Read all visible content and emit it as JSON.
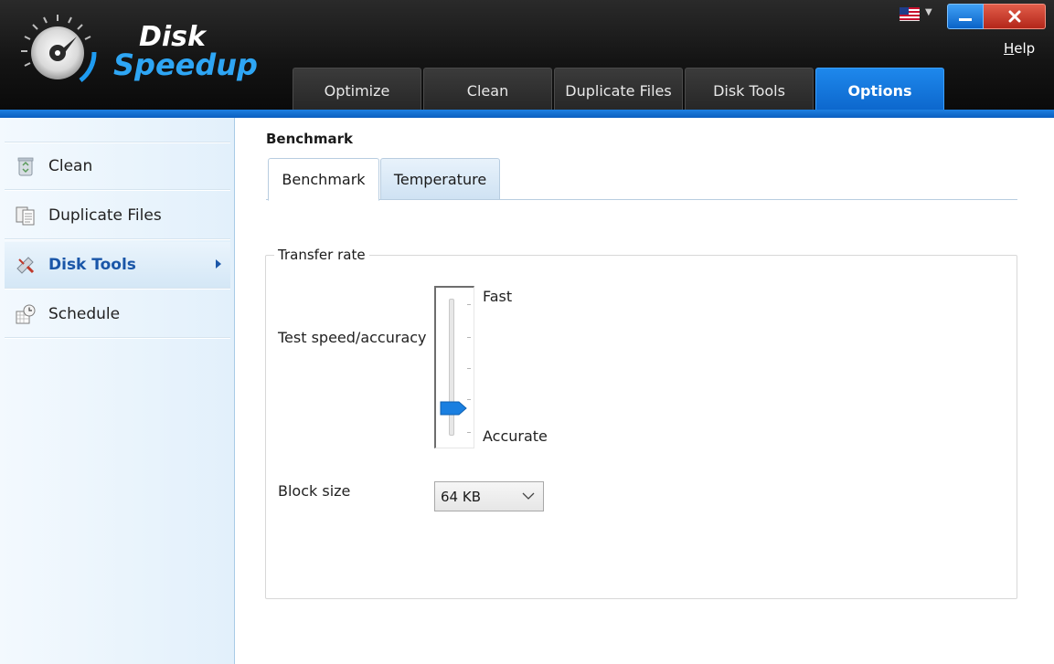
{
  "app": {
    "logo_line1": "Disk",
    "logo_line2": "Speedup",
    "help_label_first": "H",
    "help_label_rest": "elp",
    "accent_color": "#0c66cc"
  },
  "nav_tabs": [
    {
      "label": "Optimize",
      "active": false
    },
    {
      "label": "Clean",
      "active": false
    },
    {
      "label": "Duplicate Files",
      "active": false
    },
    {
      "label": "Disk Tools",
      "active": false
    },
    {
      "label": "Options",
      "active": true
    }
  ],
  "sidebar": {
    "items": [
      {
        "label": "Clean",
        "icon": "recycle-bin-icon",
        "active": false
      },
      {
        "label": "Duplicate Files",
        "icon": "duplicate-files-icon",
        "active": false
      },
      {
        "label": "Disk Tools",
        "icon": "disk-tools-icon",
        "active": true
      },
      {
        "label": "Schedule",
        "icon": "schedule-icon",
        "active": false
      }
    ]
  },
  "main": {
    "section_title": "Benchmark",
    "subtabs": [
      {
        "label": "Benchmark",
        "active": true
      },
      {
        "label": "Temperature",
        "active": false
      }
    ],
    "group_title": "Transfer rate",
    "speed_label": "Test speed/accuracy",
    "slider_top_label": "Fast",
    "slider_bottom_label": "Accurate",
    "slider_position_from_accurate": 0.2,
    "block_size_label": "Block size",
    "block_size_value": "64 KB"
  }
}
